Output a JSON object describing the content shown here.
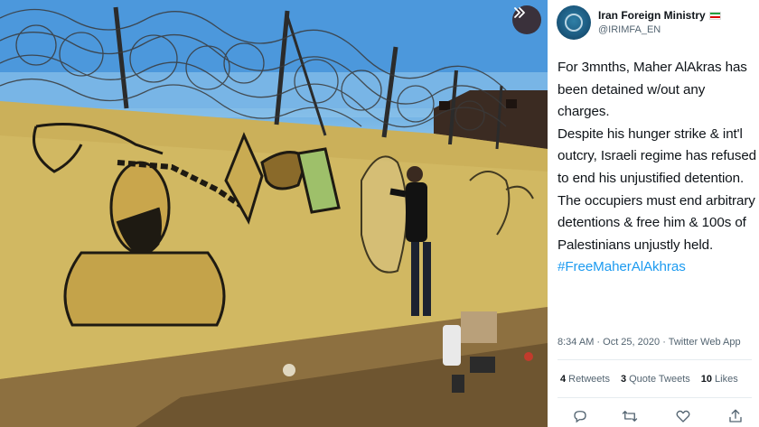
{
  "photo": {
    "alt_subject": "mural",
    "next_icon": "double-chevron-right-icon"
  },
  "tweet": {
    "author": {
      "display_name": "Iran Foreign Ministry",
      "handle": "@IRIMFA_EN",
      "flag_icon": "iran-flag-icon",
      "flag_colors": [
        "#239f40",
        "#ffffff",
        "#da0000"
      ]
    },
    "text": {
      "line1": "For 3mnths, Maher AlAkras has been detained w/out any charges.",
      "line2": "Despite his hunger strike & int'l outcry, Israeli regime has refused to end his unjustified detention.",
      "line3": "The occupiers must end arbitrary detentions & free him & 100s of Palestinians unjustly held.",
      "hashtag": "#FreeMaherAlAkhras"
    },
    "timestamp": "8:34 AM · Oct 25, 2020",
    "source": "Twitter Web App",
    "stats": {
      "retweets_count": "4",
      "retweets_label": "Retweets",
      "quotes_count": "3",
      "quotes_label": "Quote Tweets",
      "likes_count": "10",
      "likes_label": "Likes"
    },
    "actions": [
      "reply-icon",
      "retweet-icon",
      "like-icon",
      "share-icon"
    ],
    "colors": {
      "link": "#1d9bf0",
      "text": "#0f1419",
      "muted": "#536471"
    }
  }
}
